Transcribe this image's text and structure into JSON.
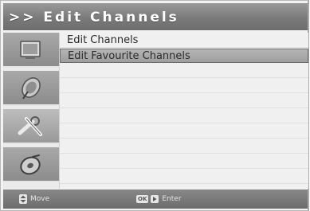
{
  "header": {
    "title": ">> Edit Channels"
  },
  "sidebar": {
    "tabs": [
      {
        "icon": "tv-icon",
        "active": false
      },
      {
        "icon": "satellite-dish-icon",
        "active": false
      },
      {
        "icon": "tools-icon",
        "active": true
      },
      {
        "icon": "disc-icon",
        "active": false
      }
    ]
  },
  "menu": {
    "items": [
      {
        "label": "Edit Channels",
        "selected": false
      },
      {
        "label": "Edit Favourite Channels",
        "selected": true
      }
    ]
  },
  "footer": {
    "move_label": "Move",
    "ok_key": "OK",
    "enter_label": "Enter"
  }
}
